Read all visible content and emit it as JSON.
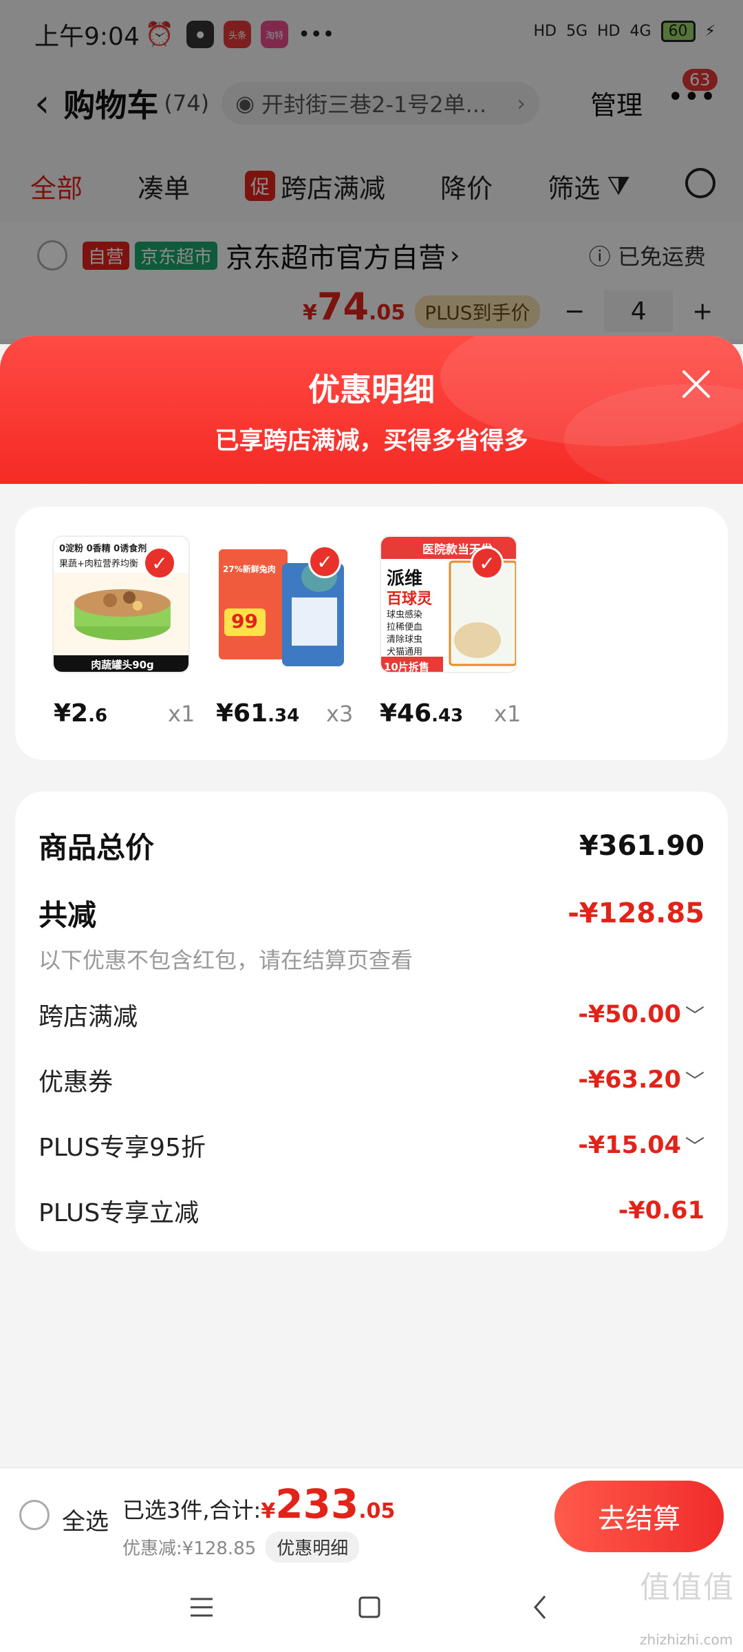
{
  "status_bar": {
    "time": "上午9:04",
    "app_badges": [
      "头条",
      "淘特"
    ],
    "network": [
      "HD",
      "5G",
      "HD",
      "4G"
    ],
    "battery": "60"
  },
  "header": {
    "title": "购物车",
    "count": "(74)",
    "address": "开封街三巷2-1号2单...",
    "manage": "管理",
    "badge": "63"
  },
  "filters": {
    "all": "全部",
    "combine": "凑单",
    "promo_tag": "促",
    "cross_store": "跨店满减",
    "price_drop": "降价",
    "filter": "筛选"
  },
  "store": {
    "tag_self": "自营",
    "tag_market": "京东超市",
    "name": "京东超市官方自营",
    "free_shipping": "已免运费",
    "price_yen": "¥",
    "price_int": "74",
    "price_dec": ".05",
    "plus_label": "PLUS到手价",
    "qty": "4",
    "minus": "−",
    "plus": "+"
  },
  "sheet": {
    "title": "优惠明细",
    "subtitle": "已享跨店满减，买得多省得多"
  },
  "products": [
    {
      "img_caption": "肉蔬罐头90g",
      "img_text": "0淀粉 0香精 0诱食剂",
      "price_int": "¥2",
      "price_dec": ".6",
      "qty": "x1"
    },
    {
      "img_caption": "",
      "img_text": "27%新鲜兔肉",
      "price_int": "¥61",
      "price_dec": ".34",
      "qty": "x3"
    },
    {
      "img_caption": "10片拆售",
      "img_text": "派维 百球灵",
      "price_int": "¥46",
      "price_dec": ".43",
      "qty": "x1"
    }
  ],
  "product_images": {
    "p1_badge": "0淀粉 0香精 0诱食剂",
    "p1_sub": "果蔬+肉粒营养均衡",
    "p2_number": "99",
    "p3_title": "派维",
    "p3_sub": "百球灵",
    "p3_top": "医院款当天发",
    "p3_points": [
      "球虫感染",
      "拉稀便血",
      "清除球虫",
      "犬猫通用"
    ]
  },
  "summary": {
    "total_label": "商品总价",
    "total_value": "¥361.90",
    "reduce_label": "共减",
    "reduce_value": "-¥128.85",
    "note": "以下优惠不包含红包，请在结算页查看",
    "rows": [
      {
        "label": "跨店满减",
        "value": "-¥50.00",
        "expand": true
      },
      {
        "label": "优惠券",
        "value": "-¥63.20",
        "expand": true
      },
      {
        "label": "PLUS专享95折",
        "value": "-¥15.04",
        "expand": true
      },
      {
        "label": "PLUS专享立减",
        "value": "-¥0.61",
        "expand": false
      }
    ]
  },
  "bottom_bar": {
    "select_all": "全选",
    "selected_text": "已选3件,合计:",
    "total_yen": "¥",
    "total_int": "233",
    "total_dec": ".05",
    "discount_text": "优惠减:¥128.85",
    "detail_label": "优惠明细",
    "checkout": "去结算"
  },
  "watermark": {
    "big": "值值值",
    "small": "zhizhizhi.com"
  },
  "colors": {
    "brand_red": "#e2231a",
    "sheet_header": "#f52a25",
    "plus_gold": "#f3dcae"
  }
}
